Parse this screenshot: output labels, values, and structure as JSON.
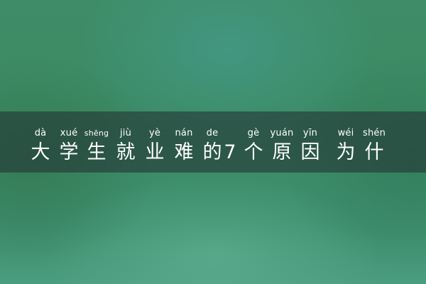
{
  "title": {
    "chars": [
      {
        "hanzi": "大",
        "pinyin": "dà"
      },
      {
        "hanzi": "学",
        "pinyin": "xué"
      },
      {
        "hanzi": "生",
        "pinyin": "shēng"
      },
      {
        "hanzi": "就",
        "pinyin": "jiù"
      },
      {
        "hanzi": "业",
        "pinyin": "yè"
      },
      {
        "hanzi": "难",
        "pinyin": "nán"
      },
      {
        "hanzi": "的",
        "pinyin": "de"
      },
      {
        "hanzi": "7",
        "pinyin": ""
      },
      {
        "hanzi": "个",
        "pinyin": "gè"
      },
      {
        "hanzi": "原",
        "pinyin": "yuán"
      },
      {
        "hanzi": "因",
        "pinyin": "yīn"
      },
      {
        "hanzi": "为",
        "pinyin": "wéi"
      },
      {
        "hanzi": "什",
        "pinyin": "shén"
      }
    ]
  },
  "colors": {
    "background": "#3d8a63",
    "band": "#233737",
    "text": "#ffffff"
  }
}
